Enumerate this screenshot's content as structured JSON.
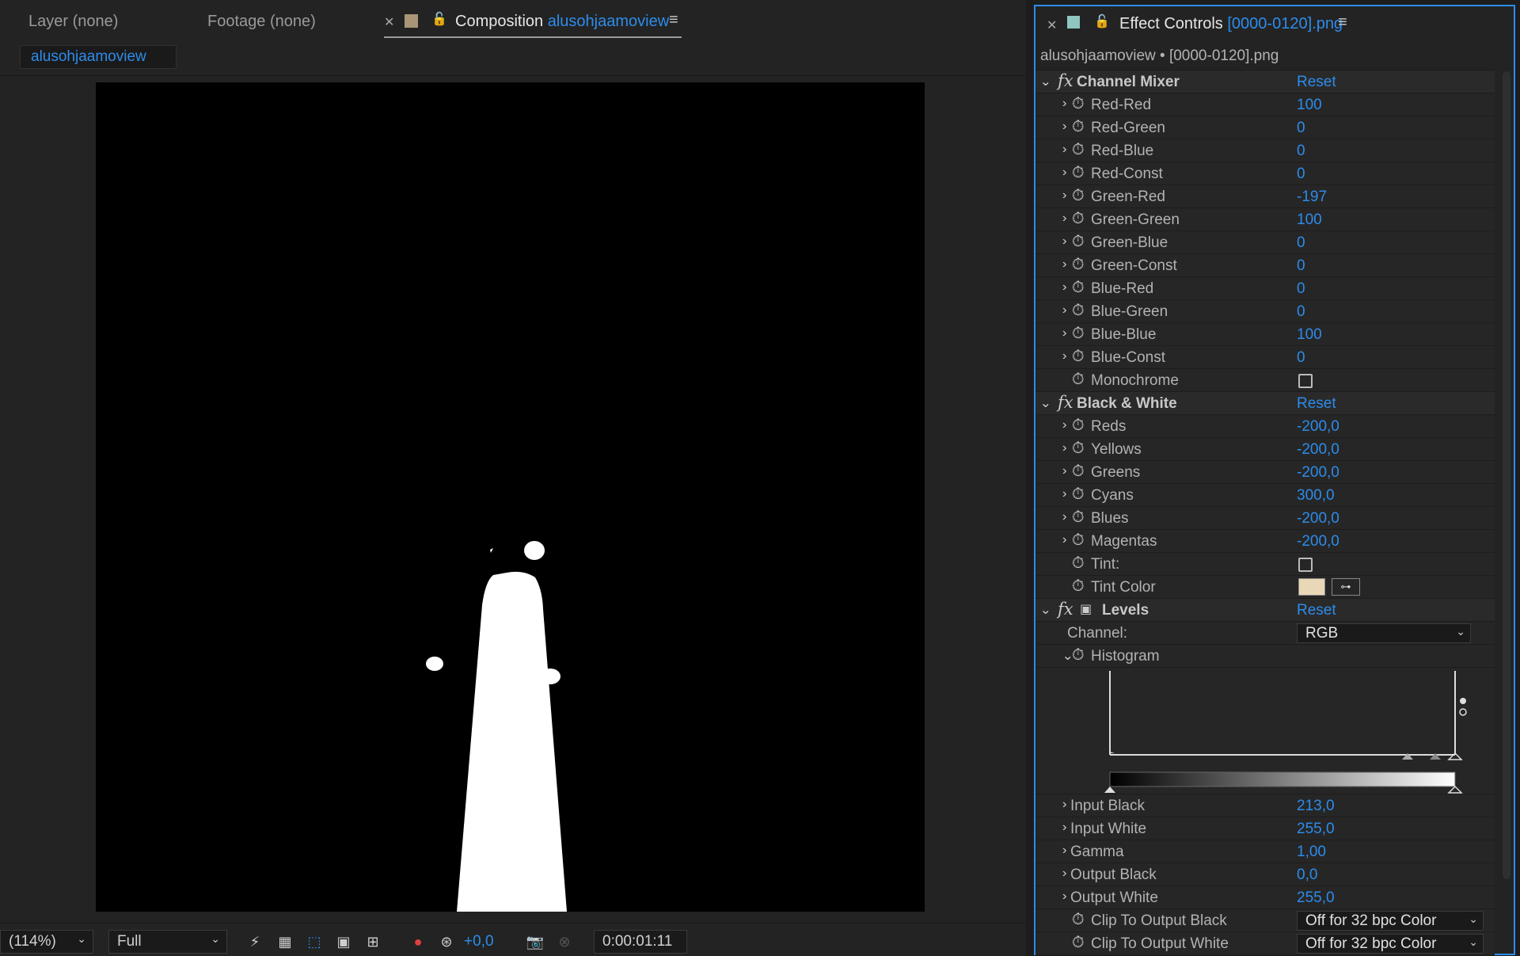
{
  "left_panel": {
    "tabs": {
      "layer": "Layer (none)",
      "footage": "Footage (none)",
      "composition_prefix": "Composition",
      "composition_name": "alusohjaamoview"
    },
    "comp_chip": "alusohjaamoview",
    "bottom_bar": {
      "zoom": "(114%)",
      "resolution": "Full",
      "exposure": "+0,0",
      "timecode": "0:00:01:11"
    }
  },
  "effect_controls": {
    "tab_prefix": "Effect Controls",
    "tab_file": "[0000-0120].png",
    "subtitle": "alusohjaamoview • [0000-0120].png",
    "channel_mixer": {
      "name": "Channel Mixer",
      "reset": "Reset",
      "params": [
        {
          "name": "Red-Red",
          "value": "100"
        },
        {
          "name": "Red-Green",
          "value": "0"
        },
        {
          "name": "Red-Blue",
          "value": "0"
        },
        {
          "name": "Red-Const",
          "value": "0"
        },
        {
          "name": "Green-Red",
          "value": "-197"
        },
        {
          "name": "Green-Green",
          "value": "100"
        },
        {
          "name": "Green-Blue",
          "value": "0"
        },
        {
          "name": "Green-Const",
          "value": "0"
        },
        {
          "name": "Blue-Red",
          "value": "0"
        },
        {
          "name": "Blue-Green",
          "value": "0"
        },
        {
          "name": "Blue-Blue",
          "value": "100"
        },
        {
          "name": "Blue-Const",
          "value": "0"
        }
      ],
      "monochrome": "Monochrome"
    },
    "black_white": {
      "name": "Black & White",
      "reset": "Reset",
      "params": [
        {
          "name": "Reds",
          "value": "-200,0"
        },
        {
          "name": "Yellows",
          "value": "-200,0"
        },
        {
          "name": "Greens",
          "value": "-200,0"
        },
        {
          "name": "Cyans",
          "value": "300,0"
        },
        {
          "name": "Blues",
          "value": "-200,0"
        },
        {
          "name": "Magentas",
          "value": "-200,0"
        }
      ],
      "tint": "Tint:",
      "tint_color": "Tint Color"
    },
    "levels": {
      "name": "Levels",
      "reset": "Reset",
      "channel_label": "Channel:",
      "channel_value": "RGB",
      "histogram": "Histogram",
      "params": [
        {
          "name": "Input Black",
          "value": "213,0"
        },
        {
          "name": "Input White",
          "value": "255,0"
        },
        {
          "name": "Gamma",
          "value": "1,00"
        },
        {
          "name": "Output Black",
          "value": "0,0"
        },
        {
          "name": "Output White",
          "value": "255,0"
        }
      ],
      "clip_black_label": "Clip To Output Black",
      "clip_black_value": "Off for 32 bpc Color",
      "clip_white_label": "Clip To Output White",
      "clip_white_value": "Off for 32 bpc Color"
    }
  },
  "colors": {
    "accent": "#2d8ceb",
    "panel_bg": "#232323",
    "composition_label": "#a89677",
    "effect_label": "#8fc6c0",
    "tint_color": "#e8d8b8"
  }
}
